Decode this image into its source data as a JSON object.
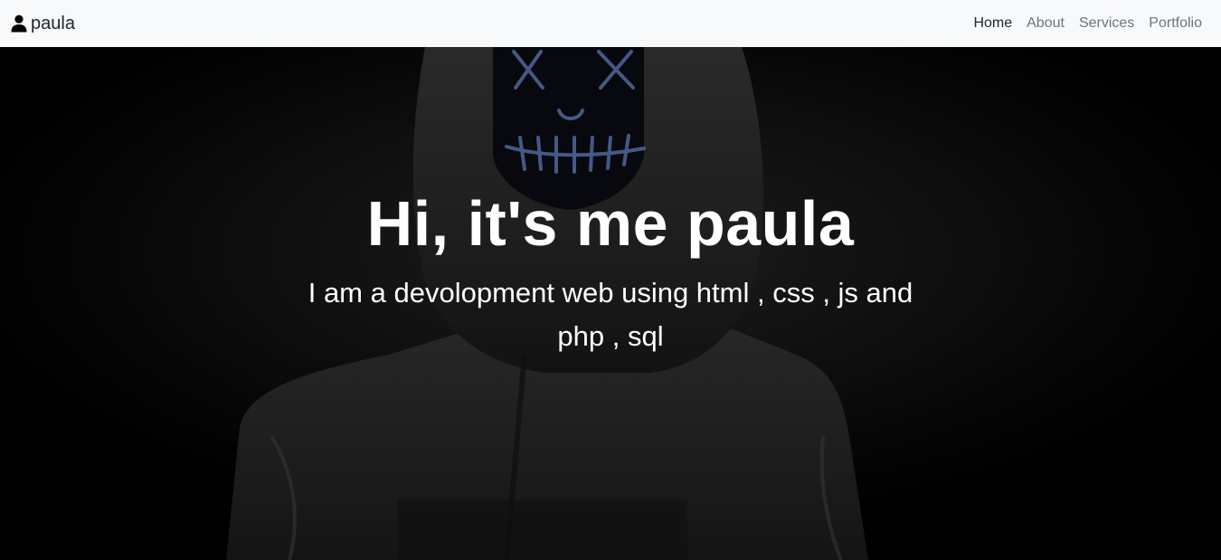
{
  "navbar": {
    "brand": "paula",
    "brand_icon": "user-icon",
    "links": [
      {
        "label": "Home",
        "active": true
      },
      {
        "label": "About",
        "active": false
      },
      {
        "label": "Services",
        "active": false
      },
      {
        "label": "Portfolio",
        "active": false
      }
    ]
  },
  "hero": {
    "title": "Hi, it's me paula",
    "subtitle": "I am a devolopment web using html , css , js and php , sql",
    "background": "hooded-figure-neon-mask-photo"
  },
  "colors": {
    "navbar_bg": "#f8f9fa",
    "nav_active": "#212529",
    "nav_inactive": "#6c757d",
    "hero_text": "#ffffff",
    "mask_neon": "#6f8fd8"
  }
}
